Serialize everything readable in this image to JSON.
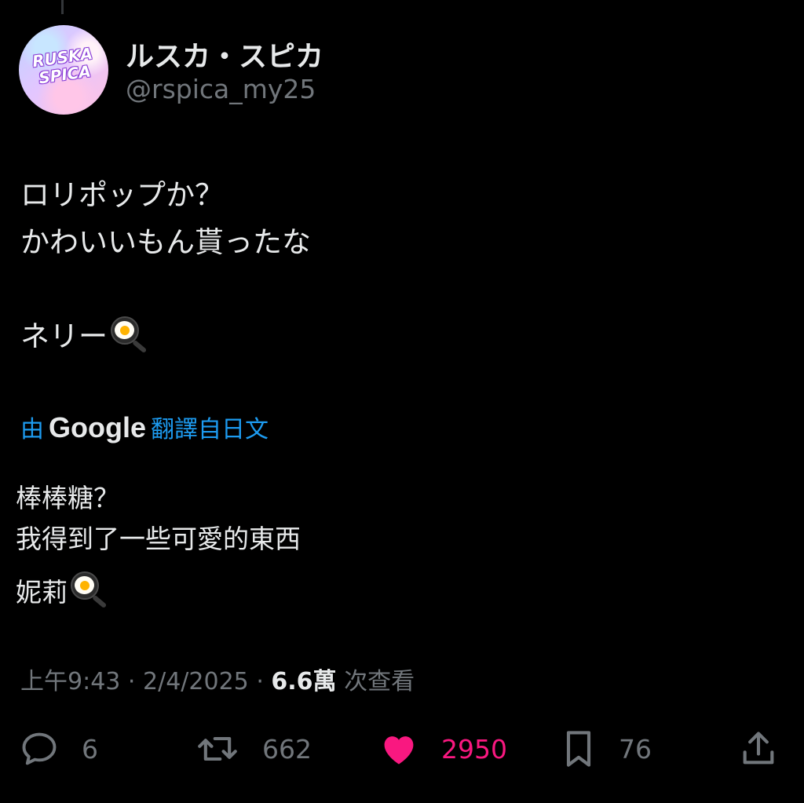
{
  "author": {
    "avatar_text": [
      "RUSKA",
      "SPICA"
    ],
    "display_name": "ルスカ・スピカ",
    "handle": "@rspica_my25"
  },
  "post": {
    "lines": [
      "ロリポップか？",
      "かわいいもん貰ったな",
      "ネリー"
    ],
    "emoji": "fried-egg-pan"
  },
  "translation": {
    "prefix": "由",
    "provider": "Google",
    "suffix": "翻譯自日文",
    "lines": [
      "棒棒糖？",
      "我得到了一些可愛的東西",
      "妮莉"
    ]
  },
  "meta": {
    "time": "上午9:43",
    "separator": "·",
    "date": "2/4/2025",
    "views_count": "6.6萬",
    "views_label": "次查看"
  },
  "actions": {
    "reply_count": "6",
    "retweet_count": "662",
    "like_count": "2950",
    "bookmark_count": "76"
  },
  "colors": {
    "background": "#000000",
    "text": "#e7e9ea",
    "secondary": "#71767b",
    "link": "#1d9bf0",
    "like": "#f91880"
  }
}
